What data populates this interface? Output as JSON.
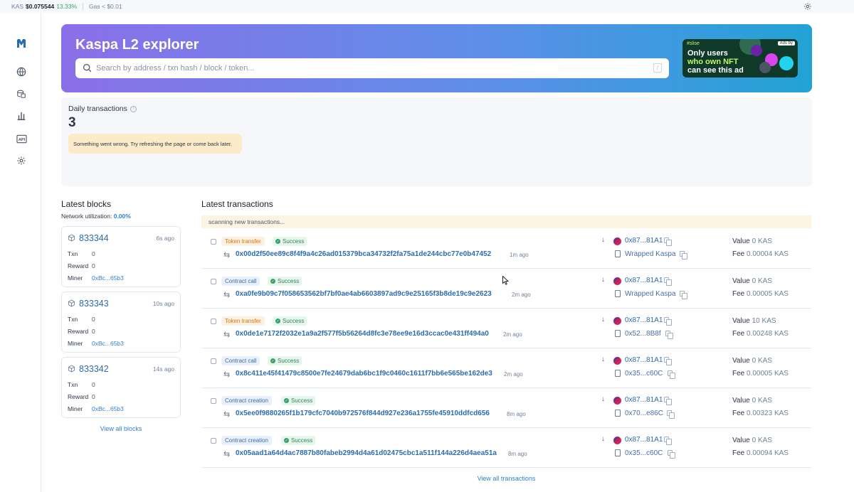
{
  "topbar": {
    "kas_label": "KAS",
    "kas_price": "$0.075544",
    "kas_change": "13.33%",
    "gas": "Gas < $0.01",
    "settings_icon": "gear-icon"
  },
  "sidebar": {
    "items": [
      {
        "icon": "logo-icon"
      },
      {
        "icon": "globe-icon"
      },
      {
        "icon": "tokens-icon"
      },
      {
        "icon": "stats-chart-icon"
      },
      {
        "icon": "api-icon",
        "label": "API"
      },
      {
        "icon": "gear-icon"
      }
    ]
  },
  "hero": {
    "title": "Kaspa L2 explorer",
    "search_placeholder": "Search by address / txn hash / block / token...",
    "search_shortcut": "/",
    "ad": {
      "brand": "#slise",
      "badge": "Ads by",
      "line1": "Only users",
      "line2": "who own NFT",
      "line3": "can see this ad"
    }
  },
  "stats": {
    "label": "Daily transactions",
    "value": "3",
    "alert": "Something went wrong. Try refreshing the page or come back later."
  },
  "blocks": {
    "title": "Latest blocks",
    "utilization_label": "Network utilization:",
    "utilization_value": "0.00%",
    "items": [
      {
        "number": "833344",
        "age": "6s ago",
        "txn_label": "Txn",
        "txn": "0",
        "reward_label": "Reward",
        "reward": "0",
        "miner_label": "Miner",
        "miner": "0xBc...65b3"
      },
      {
        "number": "833343",
        "age": "10s ago",
        "txn_label": "Txn",
        "txn": "0",
        "reward_label": "Reward",
        "reward": "0",
        "miner_label": "Miner",
        "miner": "0xBc...65b3"
      },
      {
        "number": "833342",
        "age": "14s ago",
        "txn_label": "Txn",
        "txn": "0",
        "reward_label": "Reward",
        "reward": "0",
        "miner_label": "Miner",
        "miner": "0xBc...65b3"
      }
    ],
    "view_all": "View all blocks"
  },
  "transactions": {
    "title": "Latest transactions",
    "scanning": "scanning new transactions...",
    "items": [
      {
        "type": "Token transfer",
        "status": "Success",
        "hash": "0x00d2f50ee89c8f4f9a4c26ad015379bca34732f2fa75a1de244cbc77e0b47452",
        "age": "1m ago",
        "from": "0x87...81A1",
        "to": "Wrapped Kaspa",
        "value_label": "Value",
        "value_num": "0",
        "value_unit": "KAS",
        "fee_label": "Fee",
        "fee": "0.00004 KAS"
      },
      {
        "type": "Contract call",
        "status": "Success",
        "hash": "0xa0fe9b09c7f058653562bf7bf0ae4ab6603897ad9c9e25165f3b8de19c9e2623",
        "age": "2m ago",
        "from": "0x87...81A1",
        "to": "Wrapped Kaspa",
        "value_label": "Value",
        "value_num": "0",
        "value_unit": "KAS",
        "fee_label": "Fee",
        "fee": "0.00005 KAS"
      },
      {
        "type": "Token transfer",
        "status": "Success",
        "hash": "0x0de1e7172f2032e1a9a2f577f5b56264d8fc3e78ee9e16d3ccac0e431ff494a0",
        "age": "2m ago",
        "from": "0x87...81A1",
        "to": "0x52...8B8f",
        "value_label": "Value",
        "value_num": "10",
        "value_unit": "KAS",
        "fee_label": "Fee",
        "fee": "0.00248 KAS"
      },
      {
        "type": "Contract call",
        "status": "Success",
        "hash": "0x8c411e45f41479c8500e7fe24679dab6bc1f9c0460c1611f7bb6e565be162de3",
        "age": "2m ago",
        "from": "0x87...81A1",
        "to": "0x35...c60C",
        "value_label": "Value",
        "value_num": "0",
        "value_unit": "KAS",
        "fee_label": "Fee",
        "fee": "0.00005 KAS"
      },
      {
        "type": "Contract creation",
        "status": "Success",
        "hash": "0x5ee0f9880265f1b179cfc7040b972576f844d927e236a1755fe45910ddfcd656",
        "age": "8m ago",
        "from": "0x87...81A1",
        "to": "0x70...e86C",
        "value_label": "Value",
        "value_num": "0",
        "value_unit": "KAS",
        "fee_label": "Fee",
        "fee": "0.00323 KAS"
      },
      {
        "type": "Contract creation",
        "status": "Success",
        "hash": "0x05aad1a64d4ac7887b80fabeb2994d4a61d02475cbc1a511f144a226d4aea51a",
        "age": "8m ago",
        "from": "0x87...81A1",
        "to": "0x35...c60C",
        "value_label": "Value",
        "value_num": "0",
        "value_unit": "KAS",
        "fee_label": "Fee",
        "fee": "0.00094 KAS"
      }
    ],
    "view_all": "View all transactions"
  },
  "colors": {
    "accent": "#3182ce",
    "success": "#38a169",
    "token_transfer": "#d97706",
    "contract": "#3b6ea8",
    "hero_start": "#8b6fe8",
    "hero_end": "#22a3d6"
  }
}
